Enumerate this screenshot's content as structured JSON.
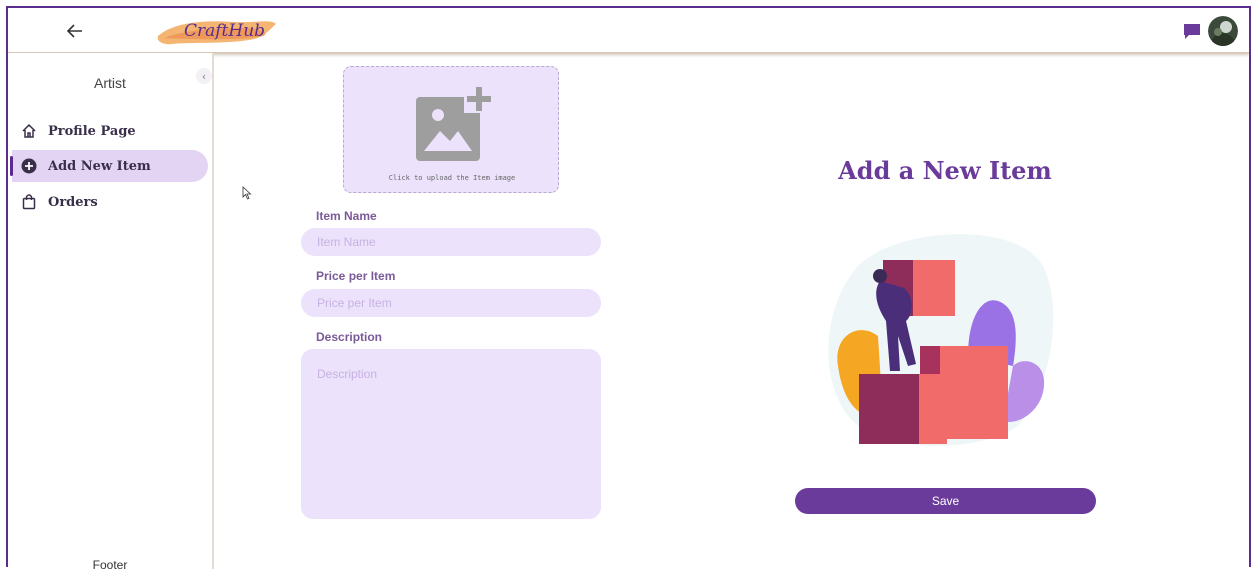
{
  "header": {
    "logo_text": "CraftHub",
    "back_icon": "arrow-left-icon",
    "chat_icon": "chat-bubble-icon",
    "accent_color": "#6a3b9a"
  },
  "sidebar": {
    "role": "Artist",
    "collapse_icon": "chevron-left-icon",
    "items": [
      {
        "label": "Profile Page",
        "icon": "home-icon"
      },
      {
        "label": "Add New Item",
        "icon": "plus-circle-icon",
        "active": true
      },
      {
        "label": "Orders",
        "icon": "shopping-bag-icon"
      }
    ],
    "footer": "Footer"
  },
  "form": {
    "upload_caption": "Click to upload the Item image",
    "item_name_label": "Item Name",
    "item_name_placeholder": "Item Name",
    "price_label": "Price per Item",
    "price_placeholder": "Price per Item",
    "description_label": "Description",
    "description_placeholder": "Description"
  },
  "panel": {
    "title": "Add a New Item",
    "save_label": "Save"
  }
}
